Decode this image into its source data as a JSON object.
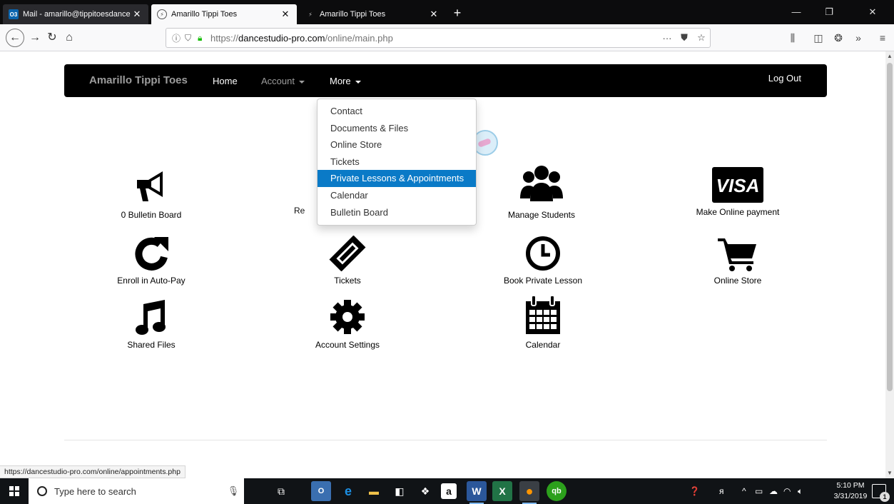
{
  "browser": {
    "tabs": [
      {
        "icon": "O3",
        "title": "Mail - amarillo@tippitoesdance",
        "close": "✕"
      },
      {
        "icon": "⚡",
        "title": "Amarillo Tippi Toes",
        "close": "✕"
      },
      {
        "icon": "⚡",
        "title": "Amarillo Tippi Toes",
        "close": "✕"
      }
    ],
    "new_tab": "+",
    "url_prefix": "https://",
    "url_host": "dancestudio-pro.com",
    "url_path": "/online/main.php",
    "page_actions": "···",
    "status_url": "https://dancestudio-pro.com/online/appointments.php",
    "window": {
      "minimize": "—",
      "restore": "❐",
      "close": "✕"
    }
  },
  "site": {
    "brand": "Amarillo Tippi Toes",
    "nav": {
      "home": "Home",
      "account": "Account",
      "more": "More",
      "logout": "Log Out"
    },
    "more_menu": [
      "Contact",
      "Documents & Files",
      "Online Store",
      "Tickets",
      "Private Lessons & Appointments",
      "Calendar",
      "Bulletin Board"
    ],
    "more_menu_active_index": 4,
    "tiles": [
      {
        "label": "0 Bulletin Board",
        "icon": "megaphone-icon"
      },
      {
        "label": "Re",
        "icon": "hidden"
      },
      {
        "label": "Manage Students",
        "icon": "users-icon"
      },
      {
        "label": "Make Online payment",
        "icon": "visa-card-icon"
      },
      {
        "label": "Enroll in Auto-Pay",
        "icon": "refresh-icon"
      },
      {
        "label": "Tickets",
        "icon": "ticket-icon"
      },
      {
        "label": "Book Private Lesson",
        "icon": "clock-icon"
      },
      {
        "label": "Online Store",
        "icon": "cart-icon"
      },
      {
        "label": "Shared Files",
        "icon": "music-note-icon"
      },
      {
        "label": "Account Settings",
        "icon": "gear-icon"
      },
      {
        "label": "Calendar",
        "icon": "calendar-icon"
      }
    ],
    "visa_text": "VISA"
  },
  "taskbar": {
    "search_placeholder": "Type here to search",
    "time": "5:10 PM",
    "date": "3/31/2019",
    "notification_count": "1"
  },
  "colors": {
    "nav_bg": "#000000",
    "menu_active": "#0a7ac7",
    "taskbar_bg": "#101316"
  }
}
